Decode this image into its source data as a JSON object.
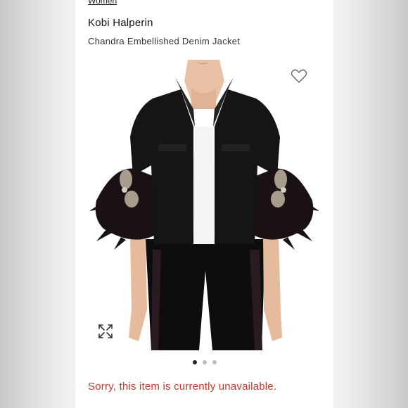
{
  "breadcrumb": "Women",
  "product": {
    "brand": "Kobi Halperin",
    "name": "Chandra Embellished Denim Jacket"
  },
  "icons": {
    "favorite": "heart-icon",
    "expand": "expand-icon"
  },
  "carousel": {
    "total": 3,
    "active_index": 0
  },
  "status_message": "Sorry, this item is currently unavailable.",
  "colors": {
    "status": "#c0392b",
    "active_dot": "#222222",
    "inactive_dot": "#bdbdbd"
  }
}
